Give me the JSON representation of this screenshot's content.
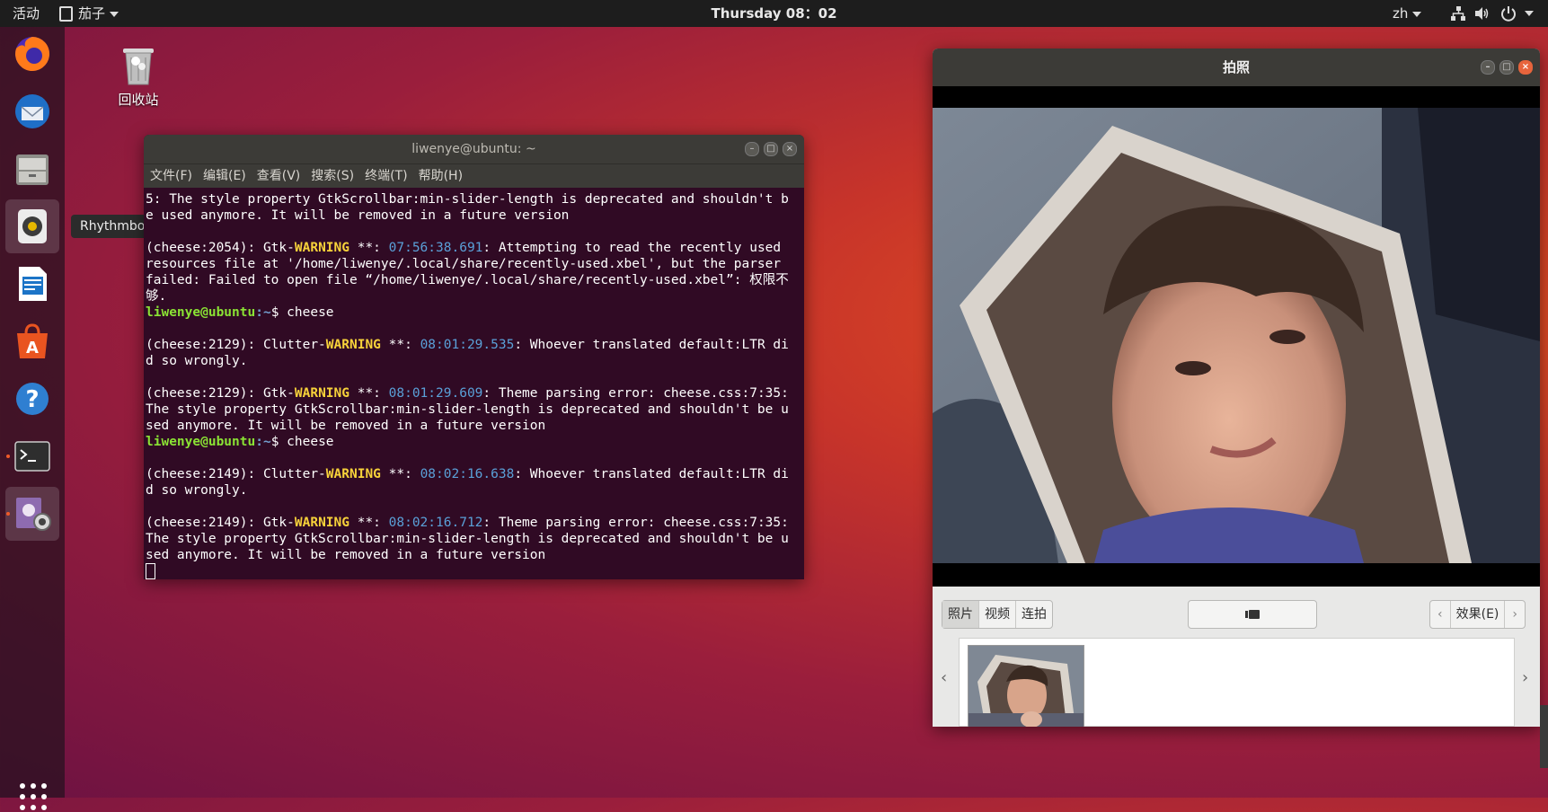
{
  "topbar": {
    "activities": "活动",
    "app_menu": "茄子",
    "clock": "Thursday 08：02",
    "lang": "zh"
  },
  "dock": {
    "tooltip": "Rhythmbox",
    "items": [
      "firefox-icon",
      "thunderbird-icon",
      "files-icon",
      "rhythmbox-icon",
      "writer-icon",
      "software-icon",
      "help-icon",
      "terminal-icon",
      "cheese-icon"
    ]
  },
  "desktop": {
    "trash_label": "回收站"
  },
  "terminal": {
    "title": "liwenye@ubuntu: ~",
    "menu": [
      "文件(F)",
      "编辑(E)",
      "查看(V)",
      "搜索(S)",
      "终端(T)",
      "帮助(H)"
    ],
    "lines": [
      {
        "t": "5: The style property GtkScrollbar:min-slider-length is deprecated and shouldn't be used anymore. It will be removed in a future version"
      },
      {
        "t": ""
      },
      {
        "pre": "(cheese:2054): Gtk-",
        "warn": "WARNING",
        "mid": " **: ",
        "ts": "07:56:38.691",
        "post": ": Attempting to read the recently used resources file at '/home/liwenye/.local/share/recently-used.xbel', but the parser failed: Failed to open file “/home/liwenye/.local/share/recently-used.xbel”: 权限不够."
      },
      {
        "user": "liwenye@ubuntu",
        "path": ":~",
        "cmd": "$ cheese"
      },
      {
        "t": ""
      },
      {
        "pre": "(cheese:2129): Clutter-",
        "warn": "WARNING",
        "mid": " **: ",
        "ts": "08:01:29.535",
        "post": ": Whoever translated default:LTR did so wrongly."
      },
      {
        "t": ""
      },
      {
        "pre": "(cheese:2129): Gtk-",
        "warn": "WARNING",
        "mid": " **: ",
        "ts": "08:01:29.609",
        "post": ": Theme parsing error: cheese.css:7:35: The style property GtkScrollbar:min-slider-length is deprecated and shouldn't be used anymore. It will be removed in a future version"
      },
      {
        "user": "liwenye@ubuntu",
        "path": ":~",
        "cmd": "$ cheese"
      },
      {
        "t": ""
      },
      {
        "pre": "(cheese:2149): Clutter-",
        "warn": "WARNING",
        "mid": " **: ",
        "ts": "08:02:16.638",
        "post": ": Whoever translated default:LTR did so wrongly."
      },
      {
        "t": ""
      },
      {
        "pre": "(cheese:2149): Gtk-",
        "warn": "WARNING",
        "mid": " **: ",
        "ts": "08:02:16.712",
        "post": ": Theme parsing error: cheese.css:7:35: The style property GtkScrollbar:min-slider-length is deprecated and shouldn't be used anymore. It will be removed in a future version"
      }
    ]
  },
  "cheese": {
    "title": "拍照",
    "mode_photo": "照片",
    "mode_video": "视频",
    "mode_burst": "连拍",
    "effects": "效果(E)",
    "prev": "‹",
    "next": "›",
    "thumb_prev": "‹",
    "thumb_next": "›"
  }
}
